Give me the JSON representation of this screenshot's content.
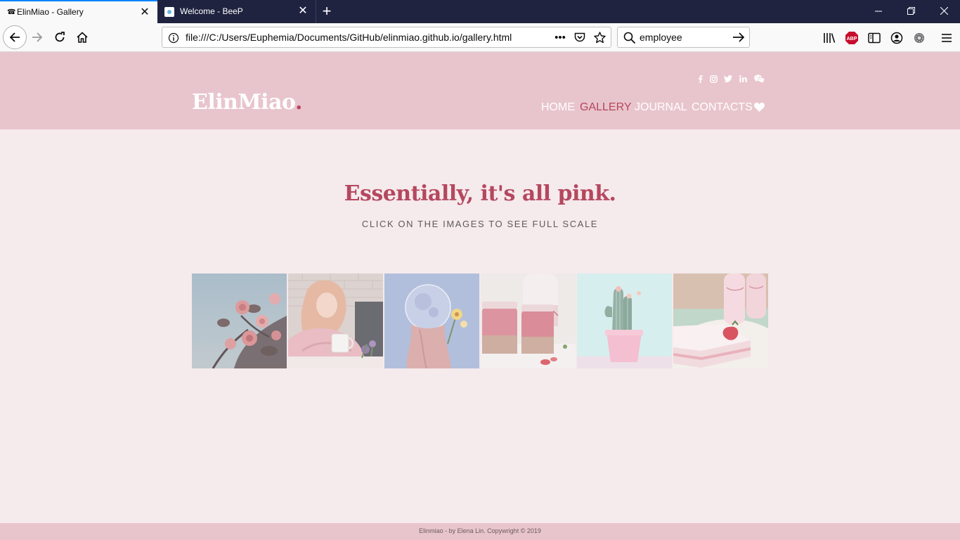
{
  "browser": {
    "tabs": [
      {
        "title": "ElinMiao - Gallery",
        "active": true
      },
      {
        "title": "Welcome - BeeP",
        "active": false
      }
    ],
    "url": "file:///C:/Users/Euphemia/Documents/GitHub/elinmiao.github.io/gallery.html",
    "search_value": "employee",
    "accent_color": "#0a84ff",
    "tabbar_color": "#1f2340",
    "icons": [
      "back-icon",
      "forward-icon",
      "reload-icon",
      "home-icon",
      "info-icon",
      "page-actions-icon",
      "pocket-icon",
      "bookmark-star-icon",
      "search-icon",
      "go-arrow-icon",
      "library-icon",
      "adblock-icon",
      "reader-sidebar-icon",
      "account-icon",
      "extension-gear-icon",
      "hamburger-menu-icon"
    ],
    "adblock_label": "ABP"
  },
  "site": {
    "logo": "ElinMiao",
    "logo_dot": ".",
    "nav": [
      "HOME",
      "GALLERY",
      "JOURNAL",
      "CONTACTS"
    ],
    "active_nav": "GALLERY",
    "social": [
      "facebook-icon",
      "instagram-icon",
      "twitter-icon",
      "linkedin-icon",
      "wechat-icon"
    ],
    "header_color": "#e8c5cc",
    "accent_color": "#b5475f",
    "background_color": "#f5eaec"
  },
  "main": {
    "headline": "Essentially, it's all pink.",
    "subline": "CLICK ON THE IMAGES TO SEE FULL SCALE"
  },
  "gallery": {
    "images": [
      {
        "subject": "pink-roses"
      },
      {
        "subject": "girl-with-mug"
      },
      {
        "subject": "bubble-girl"
      },
      {
        "subject": "pink-drinks"
      },
      {
        "subject": "potted-cactus"
      },
      {
        "subject": "strawberry-cake"
      }
    ]
  },
  "footer": {
    "text": "Elinmiao - by Elena Lin. Copywright © 2019"
  }
}
